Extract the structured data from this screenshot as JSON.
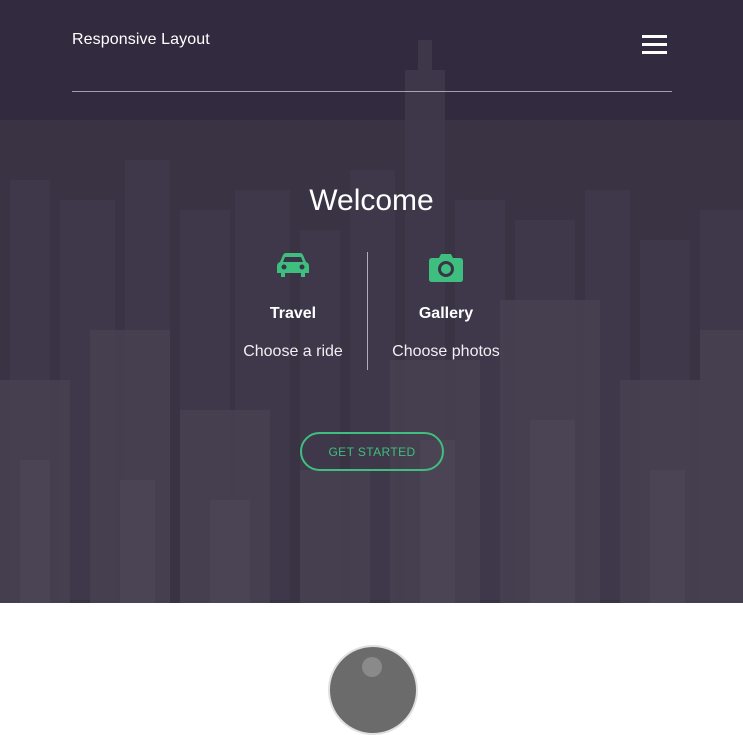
{
  "header": {
    "brand": "Responsive Layout",
    "menu_icon": "hamburger-menu-icon"
  },
  "hero": {
    "title": "Welcome",
    "features": [
      {
        "icon": "car-icon",
        "title": "Travel",
        "description": "Choose a ride"
      },
      {
        "icon": "camera-icon",
        "title": "Gallery",
        "description": "Choose photos"
      }
    ],
    "cta_label": "GET STARTED"
  },
  "colors": {
    "accent": "#3fbf7f",
    "overlay": "#2c2438",
    "text": "#ffffff"
  }
}
